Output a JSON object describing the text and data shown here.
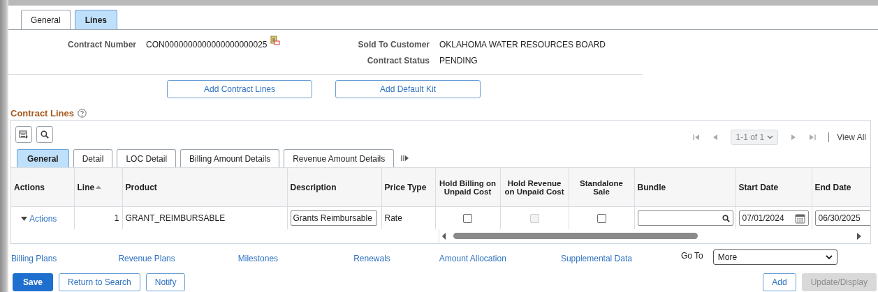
{
  "page_tabs": [
    {
      "label": "General",
      "selected": false
    },
    {
      "label": "Lines",
      "selected": true
    }
  ],
  "header": {
    "contract_number_label": "Contract Number",
    "contract_number": "CON0000000000000000000025",
    "sold_to_label": "Sold To Customer",
    "sold_to": "OKLAHOMA WATER RESOURCES BOARD",
    "status_label": "Contract Status",
    "status": "PENDING"
  },
  "action_buttons": [
    "Add Contract Lines",
    "Add Default Kit"
  ],
  "grid": {
    "title": "Contract Lines",
    "pager": "1-1 of 1",
    "view_all": "View All",
    "tabs": [
      {
        "label": "General",
        "selected": true
      },
      {
        "label": "Detail",
        "selected": false
      },
      {
        "label": "LOC Detail",
        "selected": false
      },
      {
        "label": "Billing Amount Details",
        "selected": false
      },
      {
        "label": "Revenue Amount Details",
        "selected": false
      }
    ],
    "columns": [
      {
        "label": "Actions"
      },
      {
        "label": "Line",
        "sorted": true
      },
      {
        "label": "Product"
      },
      {
        "label": "Description"
      },
      {
        "label": "Price Type"
      },
      {
        "label": "Hold Billing on Unpaid Cost"
      },
      {
        "label": "Hold Revenue on Unpaid Cost"
      },
      {
        "label": "Standalone Sale"
      },
      {
        "label": "Bundle"
      },
      {
        "label": "Start Date"
      },
      {
        "label": "End Date"
      }
    ],
    "rows": [
      {
        "cells": [
          {
            "kind": "actions",
            "text": "Actions"
          },
          {
            "kind": "number",
            "text": "1"
          },
          {
            "kind": "text",
            "text": "GRANT_REIMBURSABLE"
          },
          {
            "kind": "input",
            "value": "Grants Reimbursable"
          },
          {
            "kind": "text",
            "text": "Rate"
          },
          {
            "kind": "checkbox",
            "checked": false,
            "disabled": false
          },
          {
            "kind": "checkbox",
            "checked": false,
            "disabled": true
          },
          {
            "kind": "checkbox",
            "checked": false,
            "disabled": false
          },
          {
            "kind": "lookup"
          },
          {
            "kind": "date",
            "value": "07/01/2024"
          },
          {
            "kind": "date",
            "value": "06/30/2025"
          }
        ]
      }
    ]
  },
  "links": [
    "Billing Plans",
    "Revenue Plans",
    "Milestones",
    "Renewals",
    "Amount Allocation",
    "Supplemental Data"
  ],
  "goto": {
    "label": "Go To",
    "value": "More"
  },
  "footer_buttons": [
    {
      "label": "Save",
      "kind": "primary"
    },
    {
      "label": "Return to Search",
      "kind": "secondary"
    },
    {
      "label": "Notify",
      "kind": "secondary"
    },
    {
      "label": "Add",
      "kind": "secondary"
    },
    {
      "label": "Update/Display",
      "kind": "disabled"
    }
  ]
}
